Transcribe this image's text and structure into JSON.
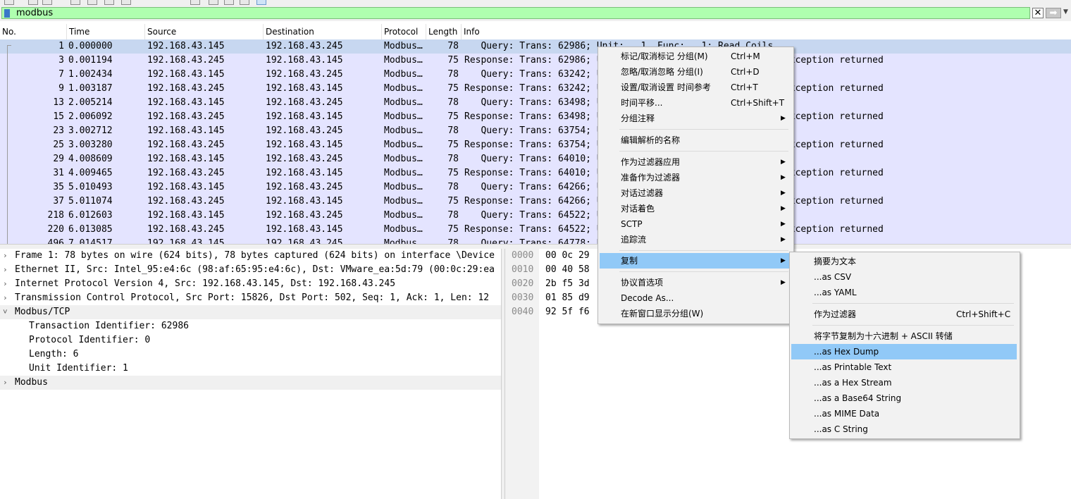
{
  "filter": {
    "text": "modbus"
  },
  "columns": {
    "no": "No.",
    "time": "Time",
    "source": "Source",
    "destination": "Destination",
    "protocol": "Protocol",
    "length": "Length",
    "info": "Info"
  },
  "packets": [
    {
      "no": "1",
      "time": "0.000000",
      "src": "192.168.43.145",
      "dst": "192.168.43.245",
      "proto": "Modbus…",
      "len": "78",
      "info": "   Query: Trans: 62986; Unit:   1, Func:   1: Read Coils",
      "selected": true
    },
    {
      "no": "3",
      "time": "0.001194",
      "src": "192.168.43.245",
      "dst": "192.168.43.145",
      "proto": "Modbus…",
      "len": "75",
      "info": "Response: Trans: 62986; Unit:   1, Func: 129: Read Coils. Exception returned"
    },
    {
      "no": "7",
      "time": "1.002434",
      "src": "192.168.43.145",
      "dst": "192.168.43.245",
      "proto": "Modbus…",
      "len": "78",
      "info": "   Query: Trans: 63242; Unit:   1, Func:   1: Read Coils"
    },
    {
      "no": "9",
      "time": "1.003187",
      "src": "192.168.43.245",
      "dst": "192.168.43.145",
      "proto": "Modbus…",
      "len": "75",
      "info": "Response: Trans: 63242; Unit:   1, Func: 129: Read Coils. Exception returned"
    },
    {
      "no": "13",
      "time": "2.005214",
      "src": "192.168.43.145",
      "dst": "192.168.43.245",
      "proto": "Modbus…",
      "len": "78",
      "info": "   Query: Trans: 63498; Unit:   1, Func:   1: Read Coils"
    },
    {
      "no": "15",
      "time": "2.006092",
      "src": "192.168.43.245",
      "dst": "192.168.43.145",
      "proto": "Modbus…",
      "len": "75",
      "info": "Response: Trans: 63498; Unit:   1, Func: 129: Read Coils. Exception returned"
    },
    {
      "no": "23",
      "time": "3.002712",
      "src": "192.168.43.145",
      "dst": "192.168.43.245",
      "proto": "Modbus…",
      "len": "78",
      "info": "   Query: Trans: 63754; Unit:   1, Func:   1: Read Coils"
    },
    {
      "no": "25",
      "time": "3.003280",
      "src": "192.168.43.245",
      "dst": "192.168.43.145",
      "proto": "Modbus…",
      "len": "75",
      "info": "Response: Trans: 63754; Unit:   1, Func: 129: Read Coils. Exception returned"
    },
    {
      "no": "29",
      "time": "4.008609",
      "src": "192.168.43.145",
      "dst": "192.168.43.245",
      "proto": "Modbus…",
      "len": "78",
      "info": "   Query: Trans: 64010; Unit:   1, Func:   1: Read Coils"
    },
    {
      "no": "31",
      "time": "4.009465",
      "src": "192.168.43.245",
      "dst": "192.168.43.145",
      "proto": "Modbus…",
      "len": "75",
      "info": "Response: Trans: 64010; Unit:   1, Func: 129: Read Coils. Exception returned"
    },
    {
      "no": "35",
      "time": "5.010493",
      "src": "192.168.43.145",
      "dst": "192.168.43.245",
      "proto": "Modbus…",
      "len": "78",
      "info": "   Query: Trans: 64266; Unit:   1, Func:   1: Read Coils"
    },
    {
      "no": "37",
      "time": "5.011074",
      "src": "192.168.43.245",
      "dst": "192.168.43.145",
      "proto": "Modbus…",
      "len": "75",
      "info": "Response: Trans: 64266; Unit:   1, Func: 129: Read Coils. Exception returned"
    },
    {
      "no": "218",
      "time": "6.012603",
      "src": "192.168.43.145",
      "dst": "192.168.43.245",
      "proto": "Modbus…",
      "len": "78",
      "info": "   Query: Trans: 64522; Unit:   1, Func:   1: Read Coils"
    },
    {
      "no": "220",
      "time": "6.013085",
      "src": "192.168.43.245",
      "dst": "192.168.43.145",
      "proto": "Modbus…",
      "len": "75",
      "info": "Response: Trans: 64522; Unit:   1, Func: 129: Read Coils. Exception returned"
    },
    {
      "no": "496",
      "time": "7.014517",
      "src": "192.168.43.145",
      "dst": "192.168.43.245",
      "proto": "Modbus…",
      "len": "78",
      "info": "   Query: Trans: 64778; Unit:   1, Func:   1: Read Coils"
    }
  ],
  "details": [
    {
      "text": "Frame 1: 78 bytes on wire (624 bits), 78 bytes captured (624 bits) on interface \\Device",
      "arrow": "›",
      "level": 0
    },
    {
      "text": "Ethernet II, Src: Intel_95:e4:6c (98:af:65:95:e4:6c), Dst: VMware_ea:5d:79 (00:0c:29:ea",
      "arrow": "›",
      "level": 0
    },
    {
      "text": "Internet Protocol Version 4, Src: 192.168.43.145, Dst: 192.168.43.245",
      "arrow": "›",
      "level": 0
    },
    {
      "text": "Transmission Control Protocol, Src Port: 15826, Dst Port: 502, Seq: 1, Ack: 1, Len: 12",
      "arrow": "›",
      "level": 0
    },
    {
      "text": "Modbus/TCP",
      "arrow": "˅",
      "level": 0,
      "highlight": true
    },
    {
      "text": "Transaction Identifier: 62986",
      "arrow": "",
      "level": 1
    },
    {
      "text": "Protocol Identifier: 0",
      "arrow": "",
      "level": 1
    },
    {
      "text": "Length: 6",
      "arrow": "",
      "level": 1
    },
    {
      "text": "Unit Identifier: 1",
      "arrow": "",
      "level": 1
    },
    {
      "text": "Modbus",
      "arrow": "›",
      "level": 0,
      "highlight": true
    }
  ],
  "bytes": [
    {
      "offset": "0000",
      "hex": "00 0c 29"
    },
    {
      "offset": "0010",
      "hex": "00 40 58"
    },
    {
      "offset": "0020",
      "hex": "2b f5 3d"
    },
    {
      "offset": "0030",
      "hex": "01 85 d9"
    },
    {
      "offset": "0040",
      "hex": "92 5f f6"
    }
  ],
  "context_menu": {
    "items": [
      {
        "label": "标记/取消标记 分组(M)",
        "shortcut": "Ctrl+M"
      },
      {
        "label": "忽略/取消忽略 分组(I)",
        "shortcut": "Ctrl+D"
      },
      {
        "label": "设置/取消设置 时间参考",
        "shortcut": "Ctrl+T"
      },
      {
        "label": "时间平移...",
        "shortcut": "Ctrl+Shift+T"
      },
      {
        "label": "分组注释",
        "submenu": true
      },
      {
        "label": "编辑解析的名称"
      },
      {
        "label": "作为过滤器应用",
        "submenu": true
      },
      {
        "label": "准备作为过滤器",
        "submenu": true
      },
      {
        "label": "对话过滤器",
        "submenu": true
      },
      {
        "label": "对话着色",
        "submenu": true
      },
      {
        "label": "SCTP",
        "submenu": true
      },
      {
        "label": "追踪流",
        "submenu": true
      },
      {
        "label": "复制",
        "submenu": true,
        "active": true
      },
      {
        "label": "协议首选项",
        "submenu": true
      },
      {
        "label": "Decode As..."
      },
      {
        "label": "在新窗口显示分组(W)"
      }
    ]
  },
  "copy_submenu": {
    "items": [
      {
        "label": "摘要为文本"
      },
      {
        "label": "...as CSV"
      },
      {
        "label": "...as YAML"
      },
      {
        "label": "作为过滤器",
        "shortcut": "Ctrl+Shift+C"
      },
      {
        "label": "将字节复制为十六进制 + ASCII 转储"
      },
      {
        "label": "...as Hex Dump",
        "active": true
      },
      {
        "label": "...as Printable Text"
      },
      {
        "label": "...as a Hex Stream"
      },
      {
        "label": "...as a Base64 String"
      },
      {
        "label": "...as MIME Data"
      },
      {
        "label": "...as C String"
      }
    ]
  },
  "colors": {
    "filter_valid": "#afffaf",
    "row_bg": "#e4e4ff",
    "row_selected": "#c7d7f0",
    "menu_highlight": "#91c9f7"
  }
}
